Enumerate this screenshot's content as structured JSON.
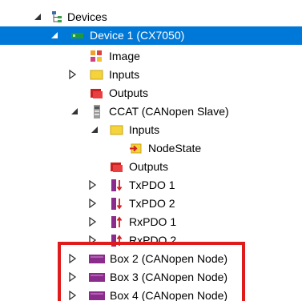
{
  "tree": {
    "root": {
      "label": "Devices",
      "icon": "devices-tree-icon",
      "state": "expanded"
    },
    "device1": {
      "label": "Device 1 (CX7050)",
      "icon": "device-icon",
      "state": "expanded",
      "selected": true
    },
    "image": {
      "label": "Image",
      "icon": "image-icon"
    },
    "inputs": {
      "label": "Inputs",
      "icon": "inputs-folder-icon",
      "state": "collapsed"
    },
    "outputs": {
      "label": "Outputs",
      "icon": "outputs-icon"
    },
    "ccat": {
      "label": "CCAT (CANopen Slave)",
      "icon": "ccat-terminal-icon",
      "state": "expanded"
    },
    "ccat_inputs": {
      "label": "Inputs",
      "icon": "inputs-folder-icon",
      "state": "expanded"
    },
    "nodestate": {
      "label": "NodeState",
      "icon": "input-variable-icon"
    },
    "ccat_outputs": {
      "label": "Outputs",
      "icon": "outputs-icon"
    },
    "txpdo1": {
      "label": "TxPDO 1",
      "icon": "txpdo-icon",
      "state": "collapsed"
    },
    "txpdo2": {
      "label": "TxPDO 2",
      "icon": "txpdo-icon",
      "state": "collapsed"
    },
    "rxpdo1": {
      "label": "RxPDO 1",
      "icon": "rxpdo-icon",
      "state": "collapsed"
    },
    "rxpdo2": {
      "label": "RxPDO 2",
      "icon": "rxpdo-icon",
      "state": "collapsed"
    },
    "box2": {
      "label": "Box 2 (CANopen Node)",
      "icon": "canopen-box-icon",
      "state": "collapsed"
    },
    "box3": {
      "label": "Box 3 (CANopen Node)",
      "icon": "canopen-box-icon",
      "state": "collapsed"
    },
    "box4": {
      "label": "Box 4 (CANopen Node)",
      "icon": "canopen-box-icon",
      "state": "collapsed"
    }
  },
  "highlight": {
    "color": "#e01b1b"
  },
  "colors": {
    "selection": "#0078d7",
    "box_icon": "#8a2c8c",
    "outputs_icon": "#cc2020",
    "folder_icon": "#f5d33b"
  }
}
